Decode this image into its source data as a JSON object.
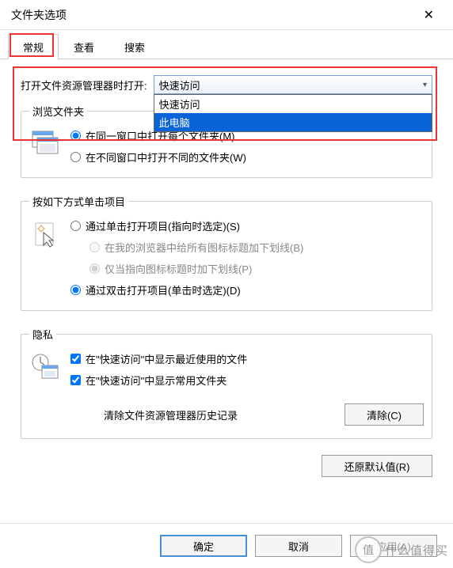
{
  "window": {
    "title": "文件夹选项"
  },
  "tabs": {
    "general": "常规",
    "view": "查看",
    "search": "搜索"
  },
  "row1": {
    "label": "打开文件资源管理器时打开:",
    "selected": "快速访问",
    "options": {
      "quick": "快速访问",
      "pc": "此电脑"
    }
  },
  "browse": {
    "legend": "浏览文件夹",
    "same": "在同一窗口中打开每个文件夹(M)",
    "diff": "在不同窗口中打开不同的文件夹(W)"
  },
  "click": {
    "legend": "按如下方式单击项目",
    "single": "通过单击打开项目(指向时选定)(S)",
    "underline_all": "在我的浏览器中给所有图标标题加下划线(B)",
    "underline_point": "仅当指向图标标题时加下划线(P)",
    "double": "通过双击打开项目(单击时选定)(D)"
  },
  "privacy": {
    "legend": "隐私",
    "recent": "在\"快速访问\"中显示最近使用的文件",
    "frequent": "在\"快速访问\"中显示常用文件夹",
    "clear_label": "清除文件资源管理器历史记录",
    "clear_btn": "清除(C)"
  },
  "restore": "还原默认值(R)",
  "dialog": {
    "ok": "确定",
    "cancel": "取消",
    "apply": "应用(A)"
  },
  "watermark": {
    "char": "值",
    "text": "什么值得买"
  }
}
